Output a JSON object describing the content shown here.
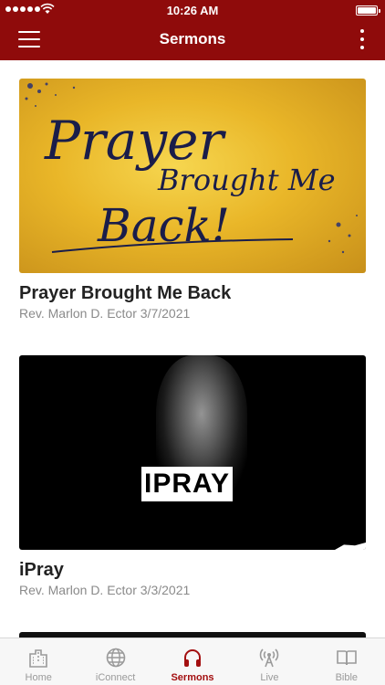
{
  "status_bar": {
    "time": "10:26 AM"
  },
  "navbar": {
    "title": "Sermons"
  },
  "sermons": [
    {
      "title": "Prayer Brought Me Back",
      "subtitle": "Rev. Marlon D. Ector 3/7/2021",
      "art_text": [
        "Prayer",
        "Brought Me",
        "Back!"
      ]
    },
    {
      "title": "iPray",
      "subtitle": "Rev. Marlon D. Ector 3/3/2021",
      "art_text": "IPRAY"
    }
  ],
  "tabs": [
    {
      "label": "Home",
      "icon": "building-icon"
    },
    {
      "label": "iConnect",
      "icon": "globe-icon"
    },
    {
      "label": "Sermons",
      "icon": "headphones-icon",
      "active": true
    },
    {
      "label": "Live",
      "icon": "broadcast-icon"
    },
    {
      "label": "Bible",
      "icon": "book-icon"
    }
  ],
  "colors": {
    "brand": "#8f0b0b",
    "active_tab": "#a30f10",
    "inactive_tab": "#9a9a9a"
  }
}
